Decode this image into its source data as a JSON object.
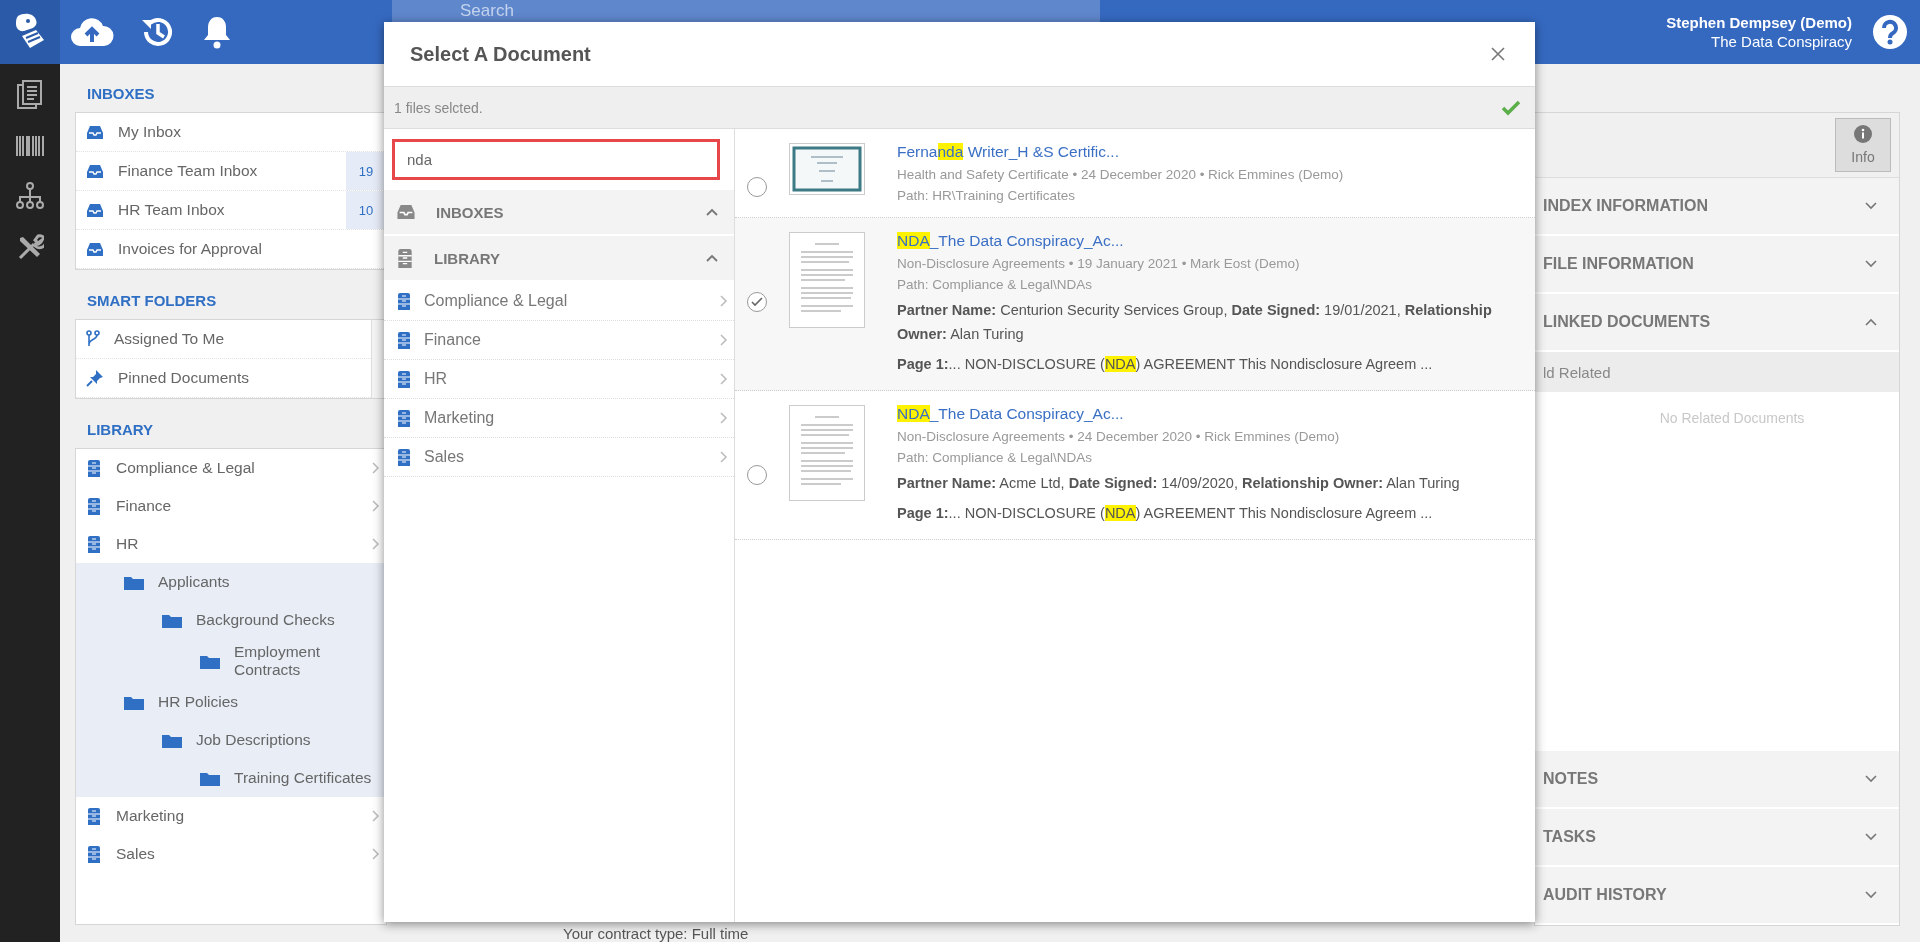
{
  "top_bar": {
    "search_placeholder": "Search",
    "user_name": "Stephen Dempsey (Demo)",
    "organization": "The Data Conspiracy"
  },
  "sidebar": {
    "inboxes_title": "INBOXES",
    "inboxes": [
      {
        "label": "My Inbox"
      },
      {
        "label": "Finance Team Inbox",
        "count": "19"
      },
      {
        "label": "HR Team Inbox",
        "count": "10"
      },
      {
        "label": "Invoices for Approval"
      }
    ],
    "smart_folders_title": "SMART FOLDERS",
    "smart_folders": [
      {
        "kind": "assigned",
        "label": "Assigned To Me"
      },
      {
        "kind": "pinned",
        "label": "Pinned Documents"
      }
    ],
    "library_title": "LIBRARY",
    "library": [
      {
        "label": "Compliance & Legal"
      },
      {
        "label": "Finance"
      },
      {
        "label": "HR",
        "children": [
          {
            "label": "Applicants",
            "children": [
              {
                "label": "Background Checks",
                "children": [
                  {
                    "label": "Employment Contracts"
                  }
                ]
              }
            ]
          },
          {
            "label": "HR Policies",
            "children": [
              {
                "label": "Job Descriptions",
                "children": [
                  {
                    "label": "Training Certificates"
                  }
                ]
              }
            ]
          }
        ]
      },
      {
        "label": "Marketing"
      },
      {
        "label": "Sales"
      }
    ]
  },
  "viewer": {
    "footer_text": "Your contract type: Full time"
  },
  "modal": {
    "title": "Select A Document",
    "status": "1 files selcted.",
    "search_value": "nda",
    "sections": [
      {
        "kind": "inboxes",
        "title": "INBOXES",
        "expanded": true
      },
      {
        "kind": "library",
        "title": "LIBRARY",
        "expanded": true
      }
    ],
    "library_items": [
      {
        "label": "Compliance & Legal"
      },
      {
        "label": "Finance"
      },
      {
        "label": "HR"
      },
      {
        "label": "Marketing"
      },
      {
        "label": "Sales"
      }
    ],
    "results": [
      {
        "selected": false,
        "kind": "certificate",
        "title": [
          {
            "text": "Ferna",
            "highlight": false
          },
          {
            "text": "nda",
            "highlight": true
          },
          {
            "text": " Writer_H &S Certific...",
            "highlight": false
          }
        ],
        "meta": "Health and Safety Certificate • 24 December 2020 • Rick Emmines (Demo)",
        "path": "Path: HR\\Training Certificates"
      },
      {
        "selected": true,
        "kind": "document",
        "title": [
          {
            "text": "NDA",
            "highlight": true
          },
          {
            "text": "_The Data Conspiracy_Ac...",
            "highlight": false
          }
        ],
        "meta": "Non-Disclosure Agreements • 19 January 2021 • Mark Eost (Demo)",
        "path": "Path: Compliance & Legal\\NDAs",
        "fields": "**Partner Name:** Centurion Security Services Group, **Date Signed:** 19/01/2021, **Relationship Owner:** Alan Turing",
        "snippet": [
          {
            "text": "Page 1:",
            "bold": true,
            "highlight": false
          },
          {
            "text": "... NON-DISCLOSURE (",
            "bold": false,
            "highlight": false
          },
          {
            "text": "NDA",
            "bold": false,
            "highlight": true
          },
          {
            "text": ") AGREEMENT This Nondisclosure Agreem ...",
            "bold": false,
            "highlight": false
          }
        ]
      },
      {
        "selected": false,
        "kind": "document",
        "title": [
          {
            "text": "NDA",
            "highlight": true
          },
          {
            "text": "_The Data Conspiracy_Ac...",
            "highlight": false
          }
        ],
        "meta": "Non-Disclosure Agreements • 24 December 2020 • Rick Emmines (Demo)",
        "path": "Path: Compliance & Legal\\NDAs",
        "fields": "**Partner Name:** Acme Ltd, **Date Signed:** 14/09/2020, **Relationship Owner:** Alan Turing",
        "snippet": [
          {
            "text": "Page 1:",
            "bold": true,
            "highlight": false
          },
          {
            "text": "... NON-DISCLOSURE (",
            "bold": false,
            "highlight": false
          },
          {
            "text": "NDA",
            "bold": false,
            "highlight": true
          },
          {
            "text": ") AGREEMENT This Nondisclosure Agreem ...",
            "bold": false,
            "highlight": false
          }
        ]
      }
    ]
  },
  "info_panel": {
    "info_button": "Info",
    "sections": [
      {
        "title": "INDEX INFORMATION",
        "expanded": false
      },
      {
        "title": "FILE INFORMATION",
        "expanded": false
      },
      {
        "title": "LINKED DOCUMENTS",
        "expanded": true,
        "toolbar_label": "ld Related",
        "empty_text": "No Related Documents"
      },
      {
        "title": "NOTES",
        "expanded": false
      },
      {
        "title": "TASKS",
        "expanded": false
      },
      {
        "title": "AUDIT HISTORY",
        "expanded": false
      }
    ]
  }
}
